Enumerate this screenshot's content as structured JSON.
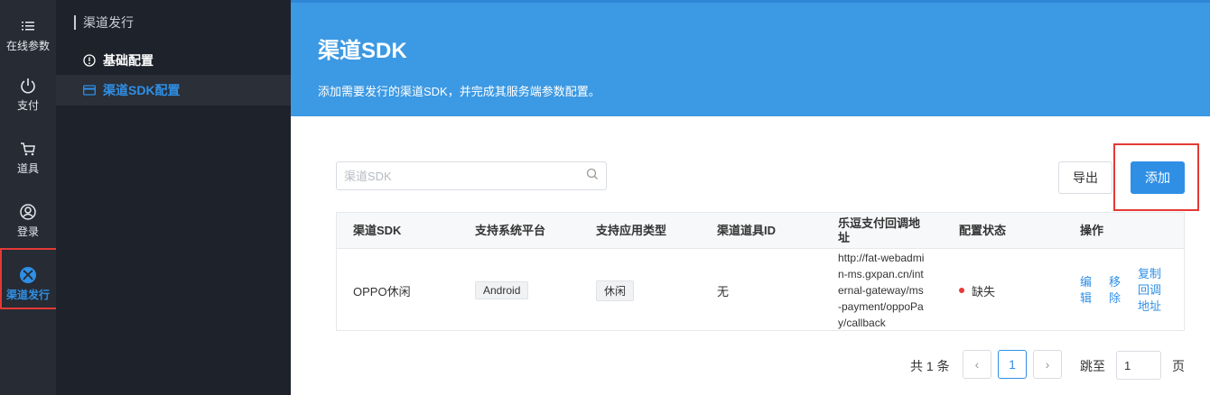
{
  "rail": {
    "items": [
      {
        "label": "在线参数",
        "icon": "list-icon"
      },
      {
        "label": "支付",
        "icon": "power-icon"
      },
      {
        "label": "道具",
        "icon": "cart-icon"
      },
      {
        "label": "登录",
        "icon": "user-circle-icon"
      },
      {
        "label": "渠道发行",
        "icon": "xbox-icon"
      }
    ],
    "active_index": 4
  },
  "subnav": {
    "title": "渠道发行",
    "items": [
      {
        "label": "基础配置",
        "icon": "info-circle-icon"
      },
      {
        "label": "渠道SDK配置",
        "icon": "card-icon"
      }
    ]
  },
  "hero": {
    "title": "渠道SDK",
    "description": "添加需要发行的渠道SDK，并完成其服务端参数配置。"
  },
  "toolbar": {
    "search_placeholder": "渠道SDK",
    "export_label": "导出",
    "add_label": "添加"
  },
  "table": {
    "headers": [
      "渠道SDK",
      "支持系统平台",
      "支持应用类型",
      "渠道道具ID",
      "乐逗支付回调地址",
      "配置状态",
      "操作"
    ],
    "rows": [
      {
        "sdk": "OPPO休闲",
        "platform": "Android",
        "app_type": "休闲",
        "item_id": "无",
        "callback_url": "http://fat-webadmin-ms.gxpan.cn/internal-gateway/ms-payment/oppoPay/callback",
        "status": "缺失",
        "actions": {
          "edit": "编辑",
          "remove": "移除",
          "copy": "复制回调地址"
        }
      }
    ]
  },
  "pagination": {
    "total_text": "共 1 条",
    "current_page": "1",
    "prev": "‹",
    "next": "›",
    "jump_label": "跳至",
    "jump_value": "1",
    "page_label": "页"
  },
  "colors": {
    "accent": "#2f8fe5",
    "hero_bg": "#3c99e3",
    "rail_bg": "#262b34",
    "subnav_bg": "#1e222a",
    "status_missing": "#e53935",
    "highlight_box": "#e53935"
  }
}
